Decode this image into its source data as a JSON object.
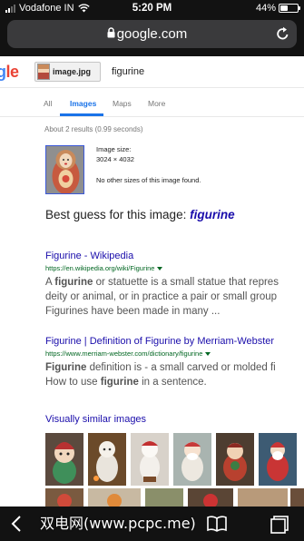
{
  "status_bar": {
    "carrier": "Vodafone IN",
    "time": "5:20 PM",
    "battery": "44%",
    "battery_level": 0.44
  },
  "browser": {
    "url": "google.com",
    "toolbar_icons": [
      "back-icon",
      "book-icon",
      "tabs-icon"
    ]
  },
  "search": {
    "logo": "gle",
    "image_chip": "image.jpg",
    "query": "figurine"
  },
  "tabs": [
    {
      "label": "All"
    },
    {
      "label": "Images"
    },
    {
      "label": "Maps"
    },
    {
      "label": "More"
    }
  ],
  "active_tab": "Images",
  "results_count": "About 2 results (0.99 seconds)",
  "image_info": {
    "size_label": "Image size:",
    "size_value": "3024 × 4032",
    "no_other": "No other sizes of this image found."
  },
  "best_guess": {
    "prefix": "Best guess for this image:",
    "term": "figurine"
  },
  "results": [
    {
      "title": "Figurine - Wikipedia",
      "url": "https://en.wikipedia.org/wiki/Figurine",
      "snippet_lines": [
        [
          "A ",
          "figurine",
          " or statuette is a small statue that repres"
        ],
        [
          "deity or animal, or in practice a pair or small group"
        ],
        [
          "Figurines have been made in many ..."
        ]
      ]
    },
    {
      "title": "Figurine | Definition of Figurine by Merriam-Webster",
      "url": "https://www.merriam-webster.com/dictionary/figurine",
      "snippet_lines": [
        [
          "",
          "Figurine",
          " definition is - a small carved or molded fi"
        ],
        [
          "How to use ",
          "figurine",
          " in a sentence."
        ]
      ]
    }
  ],
  "similar": {
    "label": "Visually similar images",
    "count_row1": 6
  },
  "watermark": "双电网(www.pcpc.me)",
  "colors": {
    "link": "#1a0dab",
    "url_green": "#006621",
    "accent": "#1a73e8",
    "chrome": "#121212"
  }
}
